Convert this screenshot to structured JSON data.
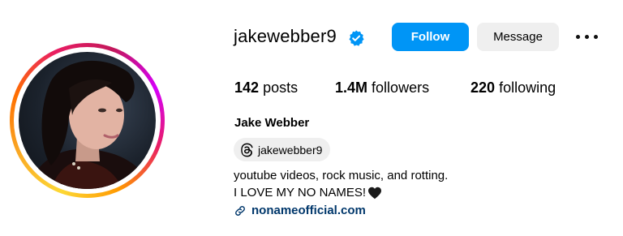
{
  "profile": {
    "username": "jakewebber9",
    "verified": true,
    "follow_label": "Follow",
    "message_label": "Message",
    "more_icon": "more-horizontal-icon",
    "full_name": "Jake Webber",
    "threads_handle": "jakewebber9",
    "bio_line1": "youtube videos, rock music, and rotting.",
    "bio_line2": "I LOVE MY NO NAMES!",
    "link": "nonameofficial.com"
  },
  "stats": {
    "posts_count": "142",
    "posts_label": "posts",
    "followers_count": "1.4M",
    "followers_label": "followers",
    "following_count": "220",
    "following_label": "following"
  },
  "colors": {
    "follow_button": "#0095f6",
    "message_button": "#efefef",
    "link": "#00376b",
    "verified_badge": "#0095f6"
  }
}
